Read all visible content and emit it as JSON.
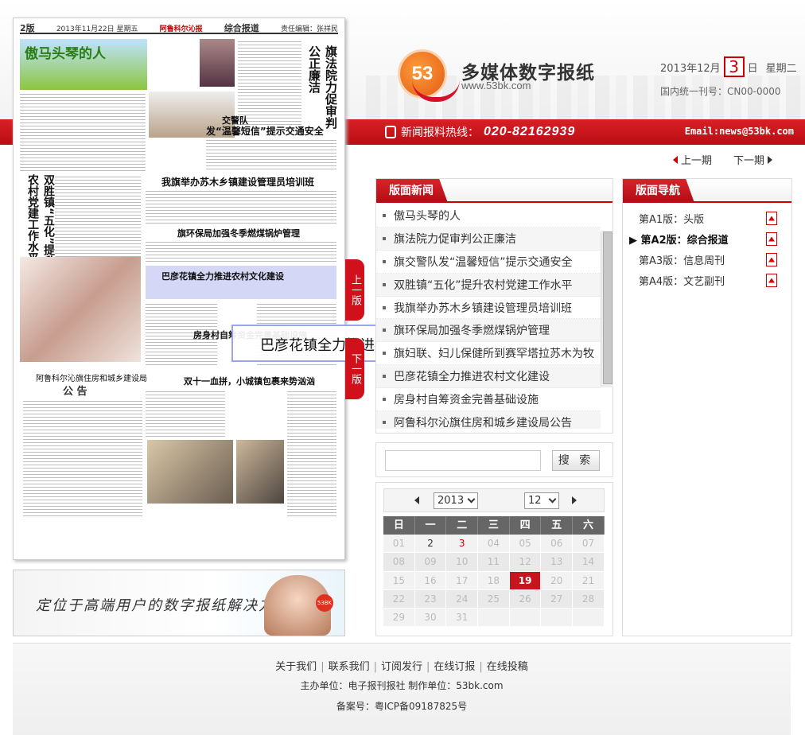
{
  "header": {
    "logo_text": "53",
    "brand": "多媒体数字报纸",
    "url": "www.53bk.com",
    "date_prefix": "2013年12月",
    "day": "3",
    "day_suffix": "日",
    "weekday": "星期二",
    "cn_number": "国内统一刊号：CN00-0000"
  },
  "redbar": {
    "hotline_label": "新闻报料热线：",
    "hotline_number": "020-82162939",
    "email": "Email:news@53bk.com"
  },
  "issue_nav": {
    "prev": "上一期",
    "next": "下一期"
  },
  "paper": {
    "edition": "2版",
    "date_line": "2013年11月22日 星期五",
    "masthead": "阿鲁科尔沁报",
    "section": "综合报道",
    "editor": "责任编辑：张祥民",
    "banner_text": "傲马头琴的人",
    "vert_title_1": "旗法院力促审判公正廉洁",
    "vert_title_2": "双胜镇“五化”提升农村党建工作水平",
    "headline_1": "我旗举办苏木乡镇建设管理员培训班",
    "headline_2": "旗环保局加强冬季燃煤锅炉管理",
    "headline_3": "巴彦花镇全力推进农村文化建设",
    "headline_4": "房身村自筹资金完善基础设施",
    "headline_5": "双十一血拼，小城镇包裹来势汹汹",
    "headline_6": "交警队",
    "headline_6b": "发“温馨短信”提示交通安全",
    "notice_title": "阿鲁科尔沁旗住房和城乡建设局",
    "notice_word": "公  告"
  },
  "tooltip": "巴彦花镇全力推进农村文化建设",
  "page_tabs": {
    "prev": "上一版",
    "next": "下一版"
  },
  "ad": {
    "slogan": "定位于高端用户的数字报纸解决方案!",
    "badge": "53BK"
  },
  "news": {
    "title": "版面新闻",
    "items": [
      "傲马头琴的人",
      "旗法院力促审判公正廉洁",
      "旗交警队发“温馨短信”提示交通安全",
      "双胜镇“五化”提升农村党建工作水平",
      "我旗举办苏木乡镇建设管理员培训班",
      "旗环保局加强冬季燃煤锅炉管理",
      "旗妇联、妇儿保健所到赛罕塔拉苏木为牧",
      "巴彦花镇全力推进农村文化建设",
      "房身村自筹资金完善基础设施",
      "阿鲁科尔沁旗住房和城乡建设局公告"
    ]
  },
  "guide": {
    "title": "版面导航",
    "items": [
      {
        "label": "第A1版：头版",
        "active": false
      },
      {
        "label": "第A2版：综合报道",
        "active": true
      },
      {
        "label": "第A3版：信息周刊",
        "active": false
      },
      {
        "label": "第A4版：文艺副刊",
        "active": false
      }
    ]
  },
  "search": {
    "value": "",
    "button": "搜 索"
  },
  "calendar": {
    "year": "2013",
    "month": "12",
    "weekdays": [
      "日",
      "一",
      "二",
      "三",
      "四",
      "五",
      "六"
    ],
    "weeks": [
      [
        "01",
        "2",
        "3",
        "04",
        "05",
        "06",
        "07"
      ],
      [
        "08",
        "09",
        "10",
        "11",
        "12",
        "13",
        "14"
      ],
      [
        "15",
        "16",
        "17",
        "18",
        "19",
        "20",
        "21"
      ],
      [
        "22",
        "23",
        "24",
        "25",
        "26",
        "27",
        "28"
      ],
      [
        "29",
        "30",
        "31",
        "",
        "",
        "",
        ""
      ]
    ],
    "linked_days": [
      "2",
      "3",
      "19"
    ],
    "selected_day": "19"
  },
  "footer": {
    "links": [
      "关于我们",
      "联系我们",
      "订阅发行",
      "在线订报",
      "在线投稿"
    ],
    "organizer": "主办单位：电子报刊报社 制作单位：53bk.com",
    "icp": "备案号：粤ICP备09187825号"
  }
}
